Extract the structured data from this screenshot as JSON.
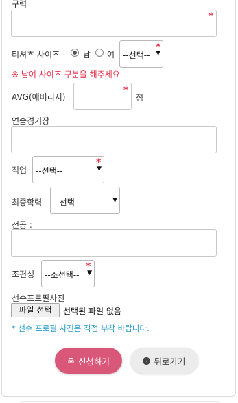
{
  "form": {
    "team_label": "구력",
    "shirt_size_label": "티셔츠 사이즈",
    "gender_male": "남",
    "gender_female": "여",
    "shirt_size_select": "--선택--",
    "gender_warning": "※ 남여 사이즈 구분을 해주세요.",
    "avg_label": "AVG(에버리지)",
    "avg_unit": "점",
    "practice_alley_label": "연습경기장",
    "job_label": "직업",
    "job_select": "--선택--",
    "education_label": "최종학력",
    "education_select": "--선택--",
    "major_label": "전공 :",
    "group_label": "조편성",
    "group_select": "--조선택--",
    "photo_label": "선수프로필사진",
    "file_button": "파일 선택",
    "file_status": "선택된 파일 없음",
    "photo_note": "* 선수 프로필 사진은 직접 부착 바랍니다.",
    "required_mark": "*"
  },
  "actions": {
    "apply_label": "신청하기",
    "back_label": "뒤로가기"
  },
  "icons": {
    "apply_icon": "car-icon",
    "back_icon": "chevron-left-circle-icon"
  },
  "colors": {
    "required": "#e0304a",
    "note": "#1e9ac2",
    "apply_button": "#d9587a",
    "back_button": "#ececec"
  }
}
